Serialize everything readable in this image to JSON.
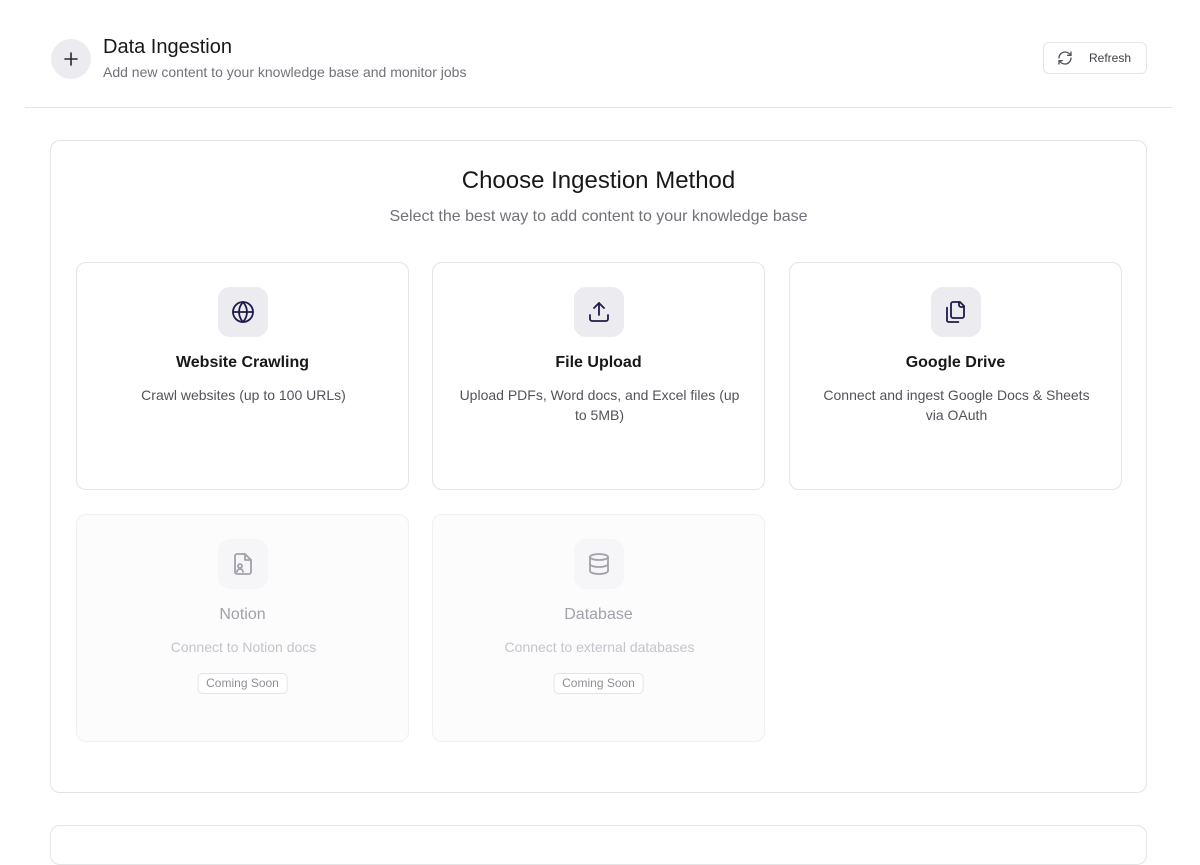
{
  "header": {
    "title": "Data Ingestion",
    "subtitle": "Add new content to your knowledge base and monitor jobs",
    "refresh_label": "Refresh"
  },
  "panel": {
    "title": "Choose Ingestion Method",
    "subtitle": "Select the best way to add content to your knowledge base"
  },
  "methods": [
    {
      "title": "Website Crawling",
      "description": "Crawl websites (up to 100 URLs)",
      "icon": "globe-icon",
      "enabled": true
    },
    {
      "title": "File Upload",
      "description": "Upload PDFs, Word docs, and Excel files (up to 5MB)",
      "icon": "upload-icon",
      "enabled": true
    },
    {
      "title": "Google Drive",
      "description": "Connect and ingest Google Docs & Sheets via OAuth",
      "icon": "copy-files-icon",
      "enabled": true
    },
    {
      "title": "Notion",
      "description": "Connect to Notion docs",
      "icon": "file-user-icon",
      "enabled": false,
      "badge": "Coming Soon"
    },
    {
      "title": "Database",
      "description": "Connect to external databases",
      "icon": "database-icon",
      "enabled": false,
      "badge": "Coming Soon"
    }
  ],
  "colors": {
    "icon_active": "#1e1b4b",
    "icon_disabled": "#a1a1aa",
    "border": "#e4e4e7"
  }
}
